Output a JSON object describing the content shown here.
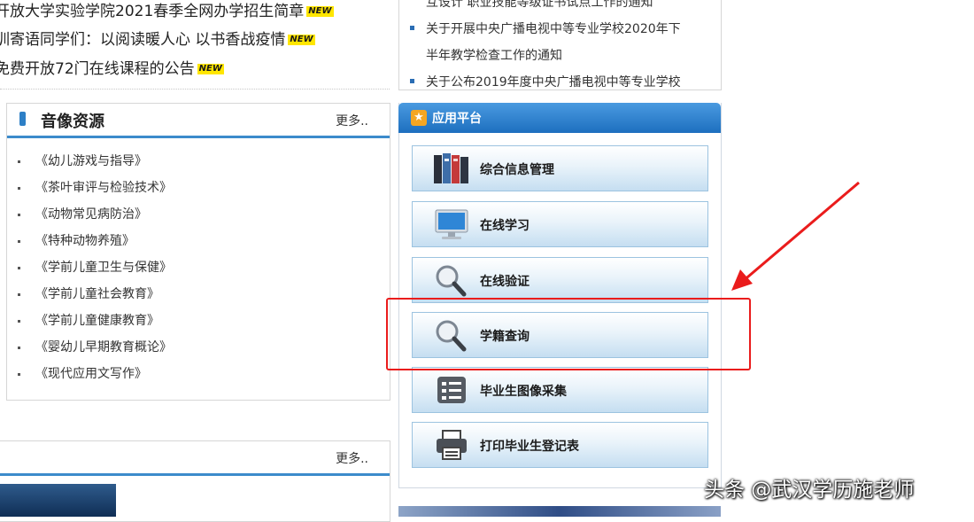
{
  "news": {
    "items": [
      {
        "text": "开放大学实验学院2021春季全网办学招生简章",
        "badge": "NEW"
      },
      {
        "text": "训寄语同学们：以阅读暖人心 以书香战疫情",
        "badge": "NEW"
      },
      {
        "text": "免费开放72门在线课程的公告",
        "badge": "NEW"
      }
    ]
  },
  "av_resources": {
    "title": "音像资源",
    "more": "更多..",
    "items": [
      "《幼儿游戏与指导》",
      "《茶叶审评与检验技术》",
      "《动物常见病防治》",
      "《特种动物养殖》",
      "《学前儿童卫生与保健》",
      "《学前儿童社会教育》",
      "《学前儿童健康教育》",
      "《婴幼儿早期教育概论》",
      "《现代应用文写作》"
    ]
  },
  "bottom_panel": {
    "more": "更多.."
  },
  "notices": {
    "items": [
      "互设计 职业技能等级证书试点工作的通知",
      "关于开展中央广播电视中等专业学校2020年下",
      "半年教学检查工作的通知",
      "关于公布2019年度中央广播电视中等专业学校"
    ]
  },
  "app_platform": {
    "title": "应用平台",
    "buttons": [
      {
        "label": "综合信息管理",
        "icon": "books-icon"
      },
      {
        "label": "在线学习",
        "icon": "monitor-icon"
      },
      {
        "label": "在线验证",
        "icon": "magnifier-icon"
      },
      {
        "label": "学籍查询",
        "icon": "magnifier-icon"
      },
      {
        "label": "毕业生图像采集",
        "icon": "checklist-icon"
      },
      {
        "label": "打印毕业生登记表",
        "icon": "printer-icon"
      }
    ]
  },
  "annotation": {
    "color": "#ea1c1c"
  },
  "watermark": "头条 @武汉学历施老师"
}
